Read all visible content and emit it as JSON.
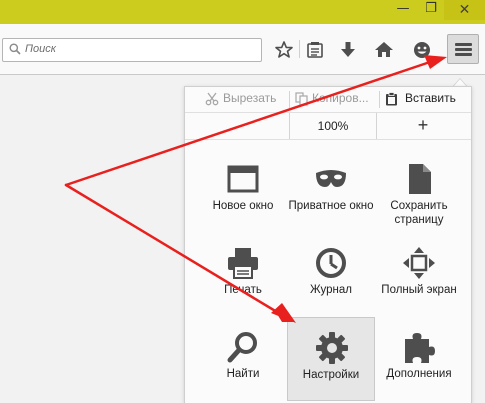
{
  "window": {
    "minimize_glyph": "—",
    "maximize_glyph": "❐",
    "close_glyph": "✕"
  },
  "toolbar": {
    "search_placeholder": "Поиск",
    "icons": [
      "bookmark-star-icon",
      "reading-list-icon",
      "download-icon",
      "home-icon",
      "smiley-icon",
      "hamburger-menu-icon"
    ]
  },
  "menu": {
    "edit": {
      "cut": "Вырезать",
      "copy": "Копиров...",
      "paste": "Вставить"
    },
    "zoom": {
      "minus": "",
      "value": "100%",
      "plus": "+"
    },
    "tiles": [
      {
        "label": "Новое окно"
      },
      {
        "label": "Приватное окно"
      },
      {
        "label": "Сохранить страницу"
      },
      {
        "label": "Печать"
      },
      {
        "label": "Журнал"
      },
      {
        "label": "Полный экран"
      },
      {
        "label": "Найти"
      },
      {
        "label": "Настройки"
      },
      {
        "label": "Дополнения"
      }
    ]
  },
  "colors": {
    "titlebar": "#cccc1e",
    "arrow": "#e8201e",
    "icon": "#4e4e4e",
    "active_tile": "#e6e6e6"
  }
}
